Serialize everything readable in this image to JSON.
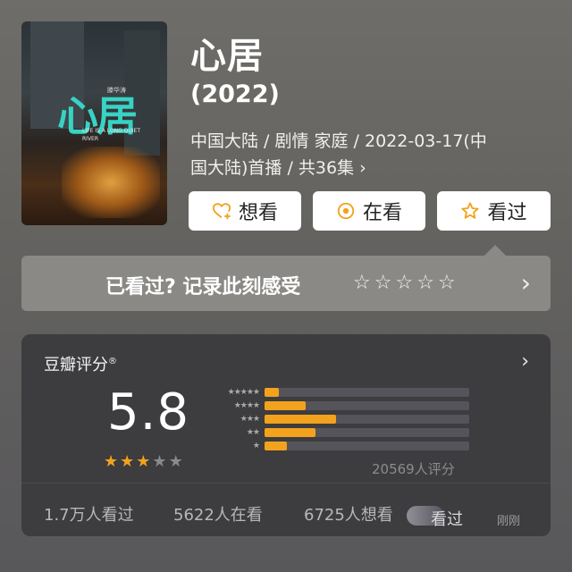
{
  "movie": {
    "title": "心居",
    "year": "(2022)",
    "meta_line1": "中国大陆 / 剧情 家庭 / 2022-03-17(中",
    "meta_line2": "国大陆)首播 / 共36集 ›",
    "poster": {
      "title": "心居",
      "tag": "滕华涛",
      "subtitle": "LIFE IS A LONG QUIET RIVER"
    }
  },
  "actions": {
    "want_label": "想看",
    "watching_label": "在看",
    "watched_label": "看过"
  },
  "record": {
    "prompt": "已看过? 记录此刻感受",
    "stars": [
      "☆",
      "☆",
      "☆",
      "☆",
      "☆"
    ]
  },
  "rating": {
    "title": "豆瓣评分",
    "trademark": "®",
    "score": "5.8",
    "stars": [
      "★",
      "★",
      "★",
      "★",
      "★"
    ],
    "star_fill": [
      1,
      1,
      1,
      0,
      0
    ],
    "count_text": "20569人评分",
    "distribution": [
      {
        "level": "★★★★★",
        "fraction": 0.07
      },
      {
        "level": "★★★★",
        "fraction": 0.2
      },
      {
        "level": "★★★",
        "fraction": 0.35
      },
      {
        "level": "★★",
        "fraction": 0.25
      },
      {
        "level": "★",
        "fraction": 0.11
      }
    ],
    "stats": {
      "watched": "1.7万人看过",
      "watching": "5622人在看",
      "want": "6725人想看"
    }
  },
  "footer": {
    "watched_label": "看过",
    "time_label": "刚刚"
  },
  "colors": {
    "accent": "#f3a21d",
    "card_bg": "#3d3c3f",
    "page_bg": "#646360",
    "button_bg": "#ffffff"
  }
}
